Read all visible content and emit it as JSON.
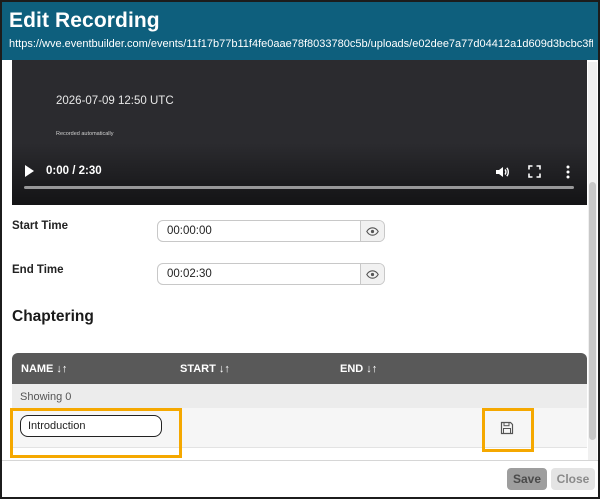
{
  "dialog": {
    "title": "Edit Recording",
    "url": "https://wve.eventbuilder.com/events/11f17b77b11f4fe0aae78f8033780c5b/uploads/e02dee7a77d04412a1d609d3bcbc3ff7..."
  },
  "video": {
    "date_text": "2026-07-09 12:50 UTC",
    "note_text": "Recorded automatically",
    "time_display": "0:00 / 2:30",
    "progress_fraction": 0.0
  },
  "fields": {
    "start_time_label": "Start Time",
    "start_time_value": "00:00:00",
    "end_time_label": "End Time",
    "end_time_value": "00:02:30"
  },
  "chaptering": {
    "title": "Chaptering",
    "columns": {
      "name": "NAME",
      "start": "START",
      "end": "END"
    },
    "showing_text": "Showing 0",
    "new_row_name": "Introduction"
  },
  "footer": {
    "save_label": "Save",
    "close_label": "Close"
  },
  "colors": {
    "title_bar": "#0e5f7d",
    "highlight": "#f5a800",
    "table_header": "#595959"
  },
  "icons": {
    "play": "play-icon",
    "volume": "volume-icon",
    "fullscreen": "fullscreen-icon",
    "more": "more-vertical-icon",
    "eye": "eye-icon",
    "sort": "sort-arrows-icon",
    "save": "floppy-disk-icon"
  }
}
